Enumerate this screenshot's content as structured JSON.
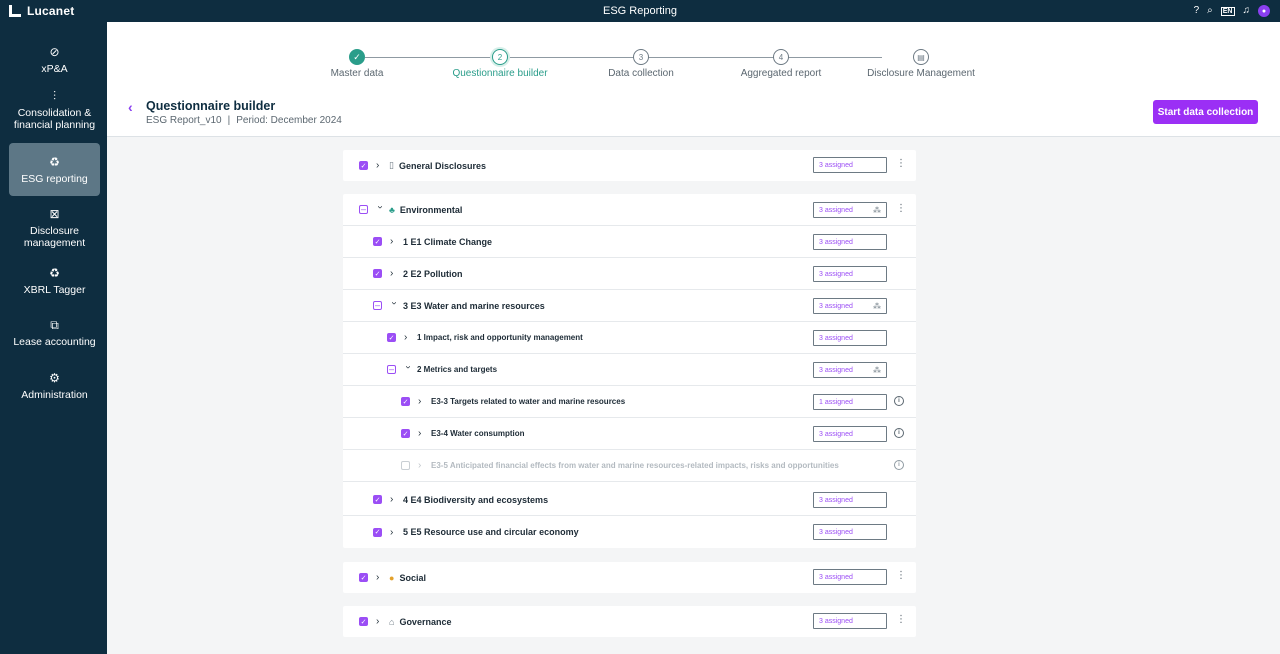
{
  "topbar": {
    "logo_text": "Lucanet",
    "title": "ESG Reporting",
    "lang": "EN",
    "icons": [
      "help-icon",
      "search-icon",
      "language-icon",
      "bell-icon",
      "user-avatar-icon"
    ]
  },
  "sidebar": {
    "items": [
      {
        "label": "xP&A",
        "icon": "compass-icon",
        "glyph": "⊘"
      },
      {
        "label": "Consolidation & financial planning",
        "icon": "chart-icon",
        "glyph": "⫶"
      },
      {
        "label": "ESG reporting",
        "icon": "leaf-icon",
        "glyph": "♻"
      },
      {
        "label": "Disclosure management",
        "icon": "document-icon",
        "glyph": "⊠"
      },
      {
        "label": "XBRL Tagger",
        "icon": "tag-icon",
        "glyph": "♻"
      },
      {
        "label": "Lease accounting",
        "icon": "lease-icon",
        "glyph": "⧉"
      },
      {
        "label": "Administration",
        "icon": "gear-icon",
        "glyph": "⚙"
      }
    ],
    "active_index": 2
  },
  "stepper": {
    "steps": [
      {
        "number": "✓",
        "label": "Master data",
        "state": "done"
      },
      {
        "number": "2",
        "label": "Questionnaire builder",
        "state": "current"
      },
      {
        "number": "3",
        "label": "Data collection",
        "state": "todo"
      },
      {
        "number": "4",
        "label": "Aggregated report",
        "state": "todo"
      },
      {
        "number": "▤",
        "label": "Disclosure Management",
        "state": "todo"
      }
    ]
  },
  "header": {
    "title": "Questionnaire builder",
    "report": "ESG Report_v10",
    "separator": "|",
    "period": "Period: December 2024",
    "primary_button": "Start data collection"
  },
  "tree": {
    "general": {
      "label": "General Disclosures",
      "assigned": "3 assigned"
    },
    "environmental": {
      "label": "Environmental",
      "assigned": "3 assigned",
      "children": [
        {
          "label": "1 E1 Climate Change",
          "assigned": "3 assigned"
        },
        {
          "label": "2 E2 Pollution",
          "assigned": "3 assigned"
        },
        {
          "label": "3 E3 Water and marine resources",
          "assigned": "3 assigned"
        },
        {
          "label": "1 Impact, risk and opportunity management",
          "assigned": "3 assigned"
        },
        {
          "label": "2 Metrics and targets",
          "assigned": "3 assigned"
        },
        {
          "label": "E3-3 Targets related to water and marine resources",
          "assigned": "1 assigned"
        },
        {
          "label": "E3-4 Water consumption",
          "assigned": "3 assigned"
        },
        {
          "label": "E3-5 Anticipated financial effects from water and marine resources-related impacts, risks and opportunities",
          "assigned": ""
        },
        {
          "label": "4 E4 Biodiversity and ecosystems",
          "assigned": "3 assigned"
        },
        {
          "label": "5 E5 Resource use and circular economy",
          "assigned": "3 assigned"
        }
      ]
    },
    "social": {
      "label": "Social",
      "assigned": "3 assigned"
    },
    "governance": {
      "label": "Governance",
      "assigned": "3 assigned"
    }
  }
}
